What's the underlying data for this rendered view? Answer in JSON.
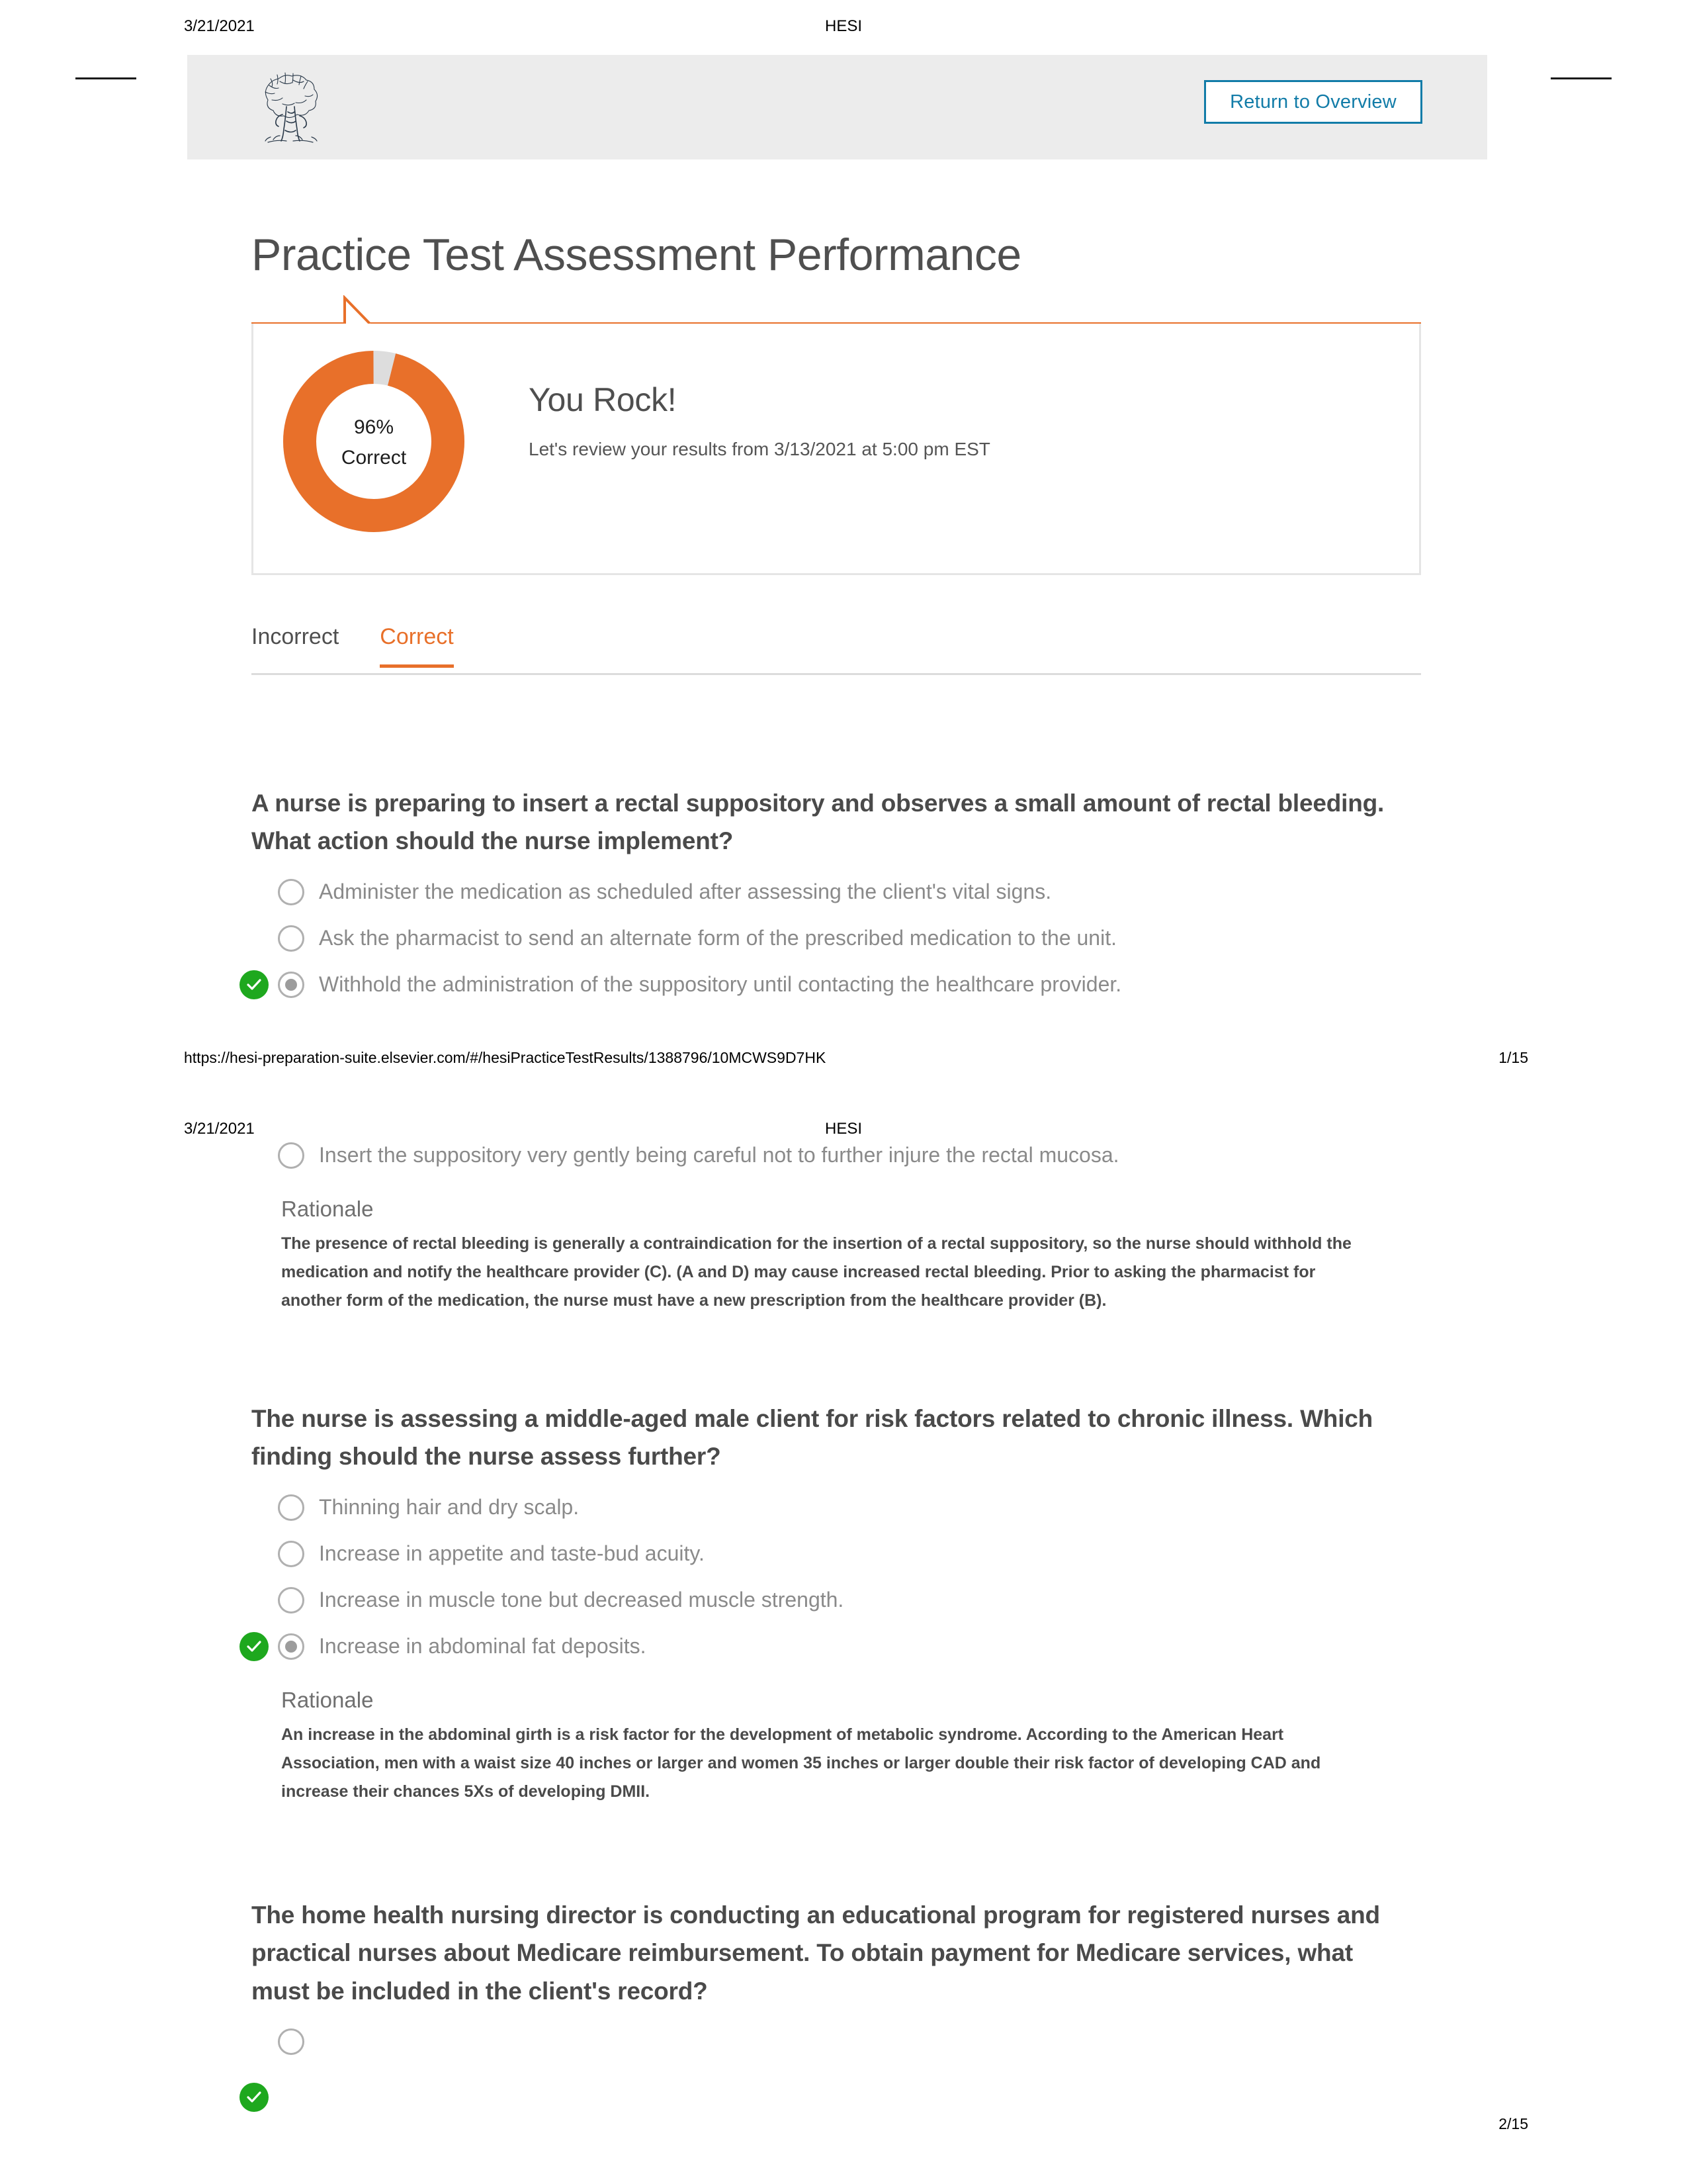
{
  "print": {
    "date": "3/21/2021",
    "doc_title": "HESI",
    "url": "https://hesi-preparation-suite.elsevier.com/#/hesiPracticeTestResults/1388796/10MCWS9D7HK",
    "page_1_of": "1/15",
    "page_2_of": "2/15"
  },
  "header": {
    "logo_alt": "elsevier-tree-logo",
    "return_button": "Return to Overview",
    "return_button_color": "#127ca8",
    "band_color": "#ececec"
  },
  "page_title": "Practice Test Assessment Performance",
  "result_card": {
    "heading": "You Rock!",
    "subtitle": "Let's review your results from 3/13/2021 at 5:00 pm EST",
    "accent_color": "#e8702a",
    "track_color": "#dddddd"
  },
  "chart_data": {
    "type": "pie",
    "title": "96% Correct",
    "labels": [
      "Correct",
      "Incorrect"
    ],
    "values": [
      96,
      4
    ],
    "colors": [
      "#e8702a",
      "#dddddd"
    ],
    "center_value": "96%",
    "center_label": "Correct",
    "donut": true,
    "legend": "none"
  },
  "tabs": [
    {
      "label": "Incorrect",
      "active": false
    },
    {
      "label": "Correct",
      "active": true
    }
  ],
  "questions": [
    {
      "prompt": "A nurse is preparing to insert a rectal suppository and observes a small amount of rectal bleeding. What action should the nurse implement?",
      "options": [
        {
          "text": "Administer the medication as scheduled after assessing the client's vital signs.",
          "selected": false,
          "correct": false
        },
        {
          "text": "Ask the pharmacist to send an alternate form of the prescribed medication to the unit.",
          "selected": false,
          "correct": false
        },
        {
          "text": "Withhold the administration of the suppository until contacting the healthcare provider.",
          "selected": true,
          "correct": true
        },
        {
          "text": "Insert the suppository very gently being careful not to further injure the rectal mucosa.",
          "selected": false,
          "correct": false
        }
      ],
      "rationale_label": "Rationale",
      "rationale": "The presence of rectal bleeding is generally a contraindication for the insertion of a rectal suppository, so the nurse should withhold the medication and notify the healthcare provider (C). (A and D) may cause increased rectal bleeding. Prior to asking the pharmacist for another form of the medication, the nurse must have a new prescription from the healthcare provider (B)."
    },
    {
      "prompt": "The nurse is assessing a middle-aged male client for risk factors related to chronic illness. Which finding should the nurse assess further?",
      "options": [
        {
          "text": "Thinning hair and dry scalp.",
          "selected": false,
          "correct": false
        },
        {
          "text": "Increase in appetite and taste-bud acuity.",
          "selected": false,
          "correct": false
        },
        {
          "text": "Increase in muscle tone but decreased muscle strength.",
          "selected": false,
          "correct": false
        },
        {
          "text": "Increase in abdominal fat deposits.",
          "selected": true,
          "correct": true
        }
      ],
      "rationale_label": "Rationale",
      "rationale": "An increase in the abdominal girth is a risk factor for the development of metabolic syndrome. According to the American Heart Association, men with a waist size 40 inches or larger and women 35 inches or larger double their risk factor of developing CAD and increase their chances 5Xs of developing DMII."
    },
    {
      "prompt": "The home health nursing director is conducting an educational program for registered nurses and practical nurses about Medicare reimbursement. To obtain payment for Medicare services, what must be included in the client's record?",
      "options": [
        {
          "text": "",
          "selected": false,
          "correct": false
        },
        {
          "text": "",
          "selected": false,
          "correct": true
        }
      ],
      "rationale_label": "",
      "rationale": ""
    }
  ]
}
